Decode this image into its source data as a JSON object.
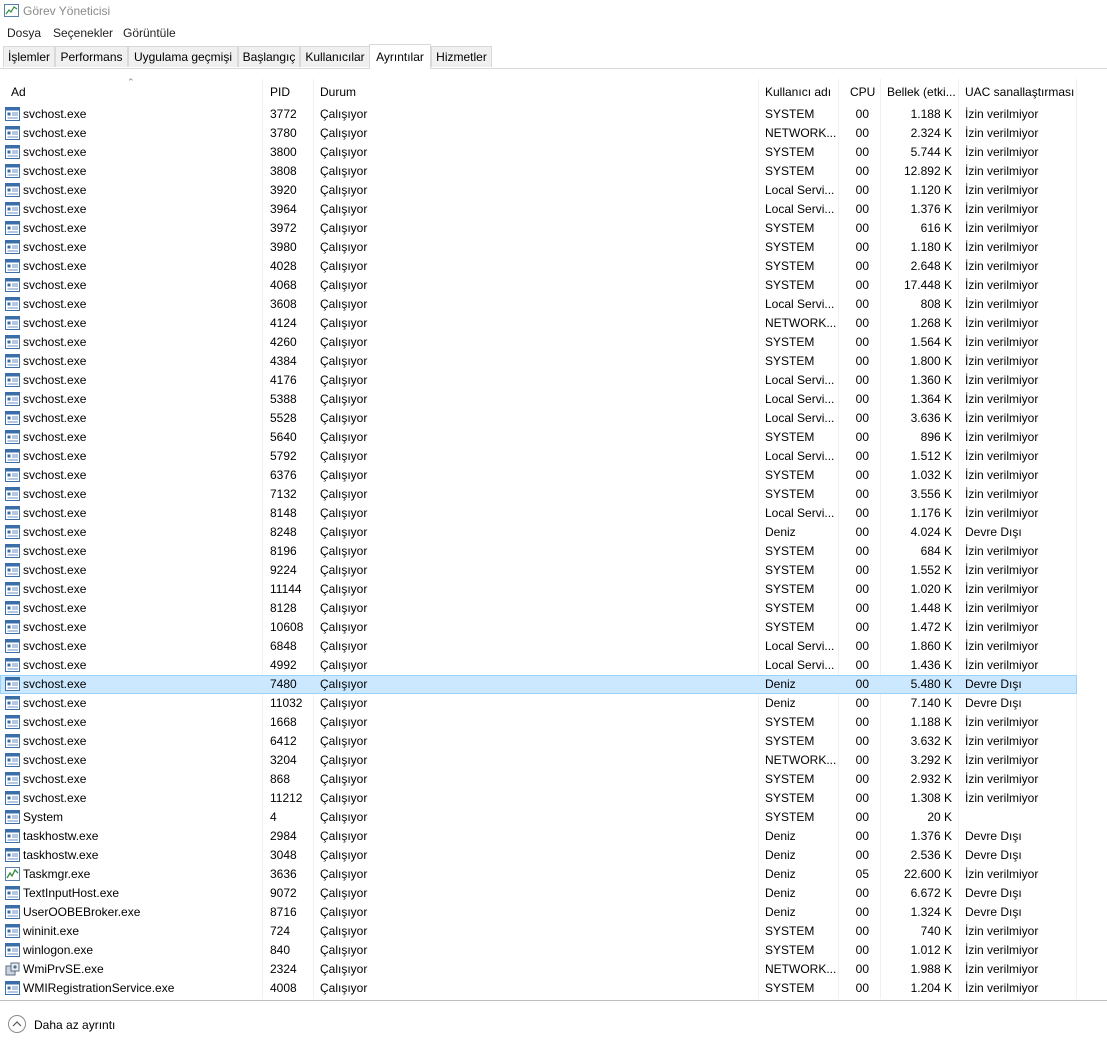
{
  "window": {
    "title": "Görev Yöneticisi"
  },
  "menu": [
    "Dosya",
    "Seçenekler",
    "Görüntüle"
  ],
  "tabs": [
    {
      "label": "İşlemler"
    },
    {
      "label": "Performans"
    },
    {
      "label": "Uygulama geçmişi"
    },
    {
      "label": "Başlangıç"
    },
    {
      "label": "Kullanıcılar"
    },
    {
      "label": "Ayrıntılar",
      "active": true
    },
    {
      "label": "Hizmetler"
    }
  ],
  "columns": {
    "name": "Ad",
    "pid": "PID",
    "status": "Durum",
    "user": "Kullanıcı adı",
    "cpu": "CPU",
    "memory": "Bellek (etki...",
    "uac": "UAC sanallaştırması"
  },
  "rows": [
    {
      "name": "svchost.exe",
      "pid": "3772",
      "status": "Çalışıyor",
      "user": "SYSTEM",
      "cpu": "00",
      "memory": "1.188 K",
      "uac": "İzin verilmiyor",
      "icon": "service"
    },
    {
      "name": "svchost.exe",
      "pid": "3780",
      "status": "Çalışıyor",
      "user": "NETWORK...",
      "cpu": "00",
      "memory": "2.324 K",
      "uac": "İzin verilmiyor",
      "icon": "service"
    },
    {
      "name": "svchost.exe",
      "pid": "3800",
      "status": "Çalışıyor",
      "user": "SYSTEM",
      "cpu": "00",
      "memory": "5.744 K",
      "uac": "İzin verilmiyor",
      "icon": "service"
    },
    {
      "name": "svchost.exe",
      "pid": "3808",
      "status": "Çalışıyor",
      "user": "SYSTEM",
      "cpu": "00",
      "memory": "12.892 K",
      "uac": "İzin verilmiyor",
      "icon": "service"
    },
    {
      "name": "svchost.exe",
      "pid": "3920",
      "status": "Çalışıyor",
      "user": "Local Servi...",
      "cpu": "00",
      "memory": "1.120 K",
      "uac": "İzin verilmiyor",
      "icon": "service"
    },
    {
      "name": "svchost.exe",
      "pid": "3964",
      "status": "Çalışıyor",
      "user": "Local Servi...",
      "cpu": "00",
      "memory": "1.376 K",
      "uac": "İzin verilmiyor",
      "icon": "service"
    },
    {
      "name": "svchost.exe",
      "pid": "3972",
      "status": "Çalışıyor",
      "user": "SYSTEM",
      "cpu": "00",
      "memory": "616 K",
      "uac": "İzin verilmiyor",
      "icon": "service"
    },
    {
      "name": "svchost.exe",
      "pid": "3980",
      "status": "Çalışıyor",
      "user": "SYSTEM",
      "cpu": "00",
      "memory": "1.180 K",
      "uac": "İzin verilmiyor",
      "icon": "service"
    },
    {
      "name": "svchost.exe",
      "pid": "4028",
      "status": "Çalışıyor",
      "user": "SYSTEM",
      "cpu": "00",
      "memory": "2.648 K",
      "uac": "İzin verilmiyor",
      "icon": "service"
    },
    {
      "name": "svchost.exe",
      "pid": "4068",
      "status": "Çalışıyor",
      "user": "SYSTEM",
      "cpu": "00",
      "memory": "17.448 K",
      "uac": "İzin verilmiyor",
      "icon": "service"
    },
    {
      "name": "svchost.exe",
      "pid": "3608",
      "status": "Çalışıyor",
      "user": "Local Servi...",
      "cpu": "00",
      "memory": "808 K",
      "uac": "İzin verilmiyor",
      "icon": "service"
    },
    {
      "name": "svchost.exe",
      "pid": "4124",
      "status": "Çalışıyor",
      "user": "NETWORK...",
      "cpu": "00",
      "memory": "1.268 K",
      "uac": "İzin verilmiyor",
      "icon": "service"
    },
    {
      "name": "svchost.exe",
      "pid": "4260",
      "status": "Çalışıyor",
      "user": "SYSTEM",
      "cpu": "00",
      "memory": "1.564 K",
      "uac": "İzin verilmiyor",
      "icon": "service"
    },
    {
      "name": "svchost.exe",
      "pid": "4384",
      "status": "Çalışıyor",
      "user": "SYSTEM",
      "cpu": "00",
      "memory": "1.800 K",
      "uac": "İzin verilmiyor",
      "icon": "service"
    },
    {
      "name": "svchost.exe",
      "pid": "4176",
      "status": "Çalışıyor",
      "user": "Local Servi...",
      "cpu": "00",
      "memory": "1.360 K",
      "uac": "İzin verilmiyor",
      "icon": "service"
    },
    {
      "name": "svchost.exe",
      "pid": "5388",
      "status": "Çalışıyor",
      "user": "Local Servi...",
      "cpu": "00",
      "memory": "1.364 K",
      "uac": "İzin verilmiyor",
      "icon": "service"
    },
    {
      "name": "svchost.exe",
      "pid": "5528",
      "status": "Çalışıyor",
      "user": "Local Servi...",
      "cpu": "00",
      "memory": "3.636 K",
      "uac": "İzin verilmiyor",
      "icon": "service"
    },
    {
      "name": "svchost.exe",
      "pid": "5640",
      "status": "Çalışıyor",
      "user": "SYSTEM",
      "cpu": "00",
      "memory": "896 K",
      "uac": "İzin verilmiyor",
      "icon": "service"
    },
    {
      "name": "svchost.exe",
      "pid": "5792",
      "status": "Çalışıyor",
      "user": "Local Servi...",
      "cpu": "00",
      "memory": "1.512 K",
      "uac": "İzin verilmiyor",
      "icon": "service"
    },
    {
      "name": "svchost.exe",
      "pid": "6376",
      "status": "Çalışıyor",
      "user": "SYSTEM",
      "cpu": "00",
      "memory": "1.032 K",
      "uac": "İzin verilmiyor",
      "icon": "service"
    },
    {
      "name": "svchost.exe",
      "pid": "7132",
      "status": "Çalışıyor",
      "user": "SYSTEM",
      "cpu": "00",
      "memory": "3.556 K",
      "uac": "İzin verilmiyor",
      "icon": "service"
    },
    {
      "name": "svchost.exe",
      "pid": "8148",
      "status": "Çalışıyor",
      "user": "Local Servi...",
      "cpu": "00",
      "memory": "1.176 K",
      "uac": "İzin verilmiyor",
      "icon": "service"
    },
    {
      "name": "svchost.exe",
      "pid": "8248",
      "status": "Çalışıyor",
      "user": "Deniz",
      "cpu": "00",
      "memory": "4.024 K",
      "uac": "Devre Dışı",
      "icon": "service"
    },
    {
      "name": "svchost.exe",
      "pid": "8196",
      "status": "Çalışıyor",
      "user": "SYSTEM",
      "cpu": "00",
      "memory": "684 K",
      "uac": "İzin verilmiyor",
      "icon": "service"
    },
    {
      "name": "svchost.exe",
      "pid": "9224",
      "status": "Çalışıyor",
      "user": "SYSTEM",
      "cpu": "00",
      "memory": "1.552 K",
      "uac": "İzin verilmiyor",
      "icon": "service"
    },
    {
      "name": "svchost.exe",
      "pid": "11144",
      "status": "Çalışıyor",
      "user": "SYSTEM",
      "cpu": "00",
      "memory": "1.020 K",
      "uac": "İzin verilmiyor",
      "icon": "service"
    },
    {
      "name": "svchost.exe",
      "pid": "8128",
      "status": "Çalışıyor",
      "user": "SYSTEM",
      "cpu": "00",
      "memory": "1.448 K",
      "uac": "İzin verilmiyor",
      "icon": "service"
    },
    {
      "name": "svchost.exe",
      "pid": "10608",
      "status": "Çalışıyor",
      "user": "SYSTEM",
      "cpu": "00",
      "memory": "1.472 K",
      "uac": "İzin verilmiyor",
      "icon": "service"
    },
    {
      "name": "svchost.exe",
      "pid": "6848",
      "status": "Çalışıyor",
      "user": "Local Servi...",
      "cpu": "00",
      "memory": "1.860 K",
      "uac": "İzin verilmiyor",
      "icon": "service"
    },
    {
      "name": "svchost.exe",
      "pid": "4992",
      "status": "Çalışıyor",
      "user": "Local Servi...",
      "cpu": "00",
      "memory": "1.436 K",
      "uac": "İzin verilmiyor",
      "icon": "service"
    },
    {
      "name": "svchost.exe",
      "pid": "7480",
      "status": "Çalışıyor",
      "user": "Deniz",
      "cpu": "00",
      "memory": "5.480 K",
      "uac": "Devre Dışı",
      "icon": "service",
      "selected": true
    },
    {
      "name": "svchost.exe",
      "pid": "11032",
      "status": "Çalışıyor",
      "user": "Deniz",
      "cpu": "00",
      "memory": "7.140 K",
      "uac": "Devre Dışı",
      "icon": "service"
    },
    {
      "name": "svchost.exe",
      "pid": "1668",
      "status": "Çalışıyor",
      "user": "SYSTEM",
      "cpu": "00",
      "memory": "1.188 K",
      "uac": "İzin verilmiyor",
      "icon": "service"
    },
    {
      "name": "svchost.exe",
      "pid": "6412",
      "status": "Çalışıyor",
      "user": "SYSTEM",
      "cpu": "00",
      "memory": "3.632 K",
      "uac": "İzin verilmiyor",
      "icon": "service"
    },
    {
      "name": "svchost.exe",
      "pid": "3204",
      "status": "Çalışıyor",
      "user": "NETWORK...",
      "cpu": "00",
      "memory": "3.292 K",
      "uac": "İzin verilmiyor",
      "icon": "service"
    },
    {
      "name": "svchost.exe",
      "pid": "868",
      "status": "Çalışıyor",
      "user": "SYSTEM",
      "cpu": "00",
      "memory": "2.932 K",
      "uac": "İzin verilmiyor",
      "icon": "service"
    },
    {
      "name": "svchost.exe",
      "pid": "11212",
      "status": "Çalışıyor",
      "user": "SYSTEM",
      "cpu": "00",
      "memory": "1.308 K",
      "uac": "İzin verilmiyor",
      "icon": "service"
    },
    {
      "name": "System",
      "pid": "4",
      "status": "Çalışıyor",
      "user": "SYSTEM",
      "cpu": "00",
      "memory": "20 K",
      "uac": "",
      "icon": "service"
    },
    {
      "name": "taskhostw.exe",
      "pid": "2984",
      "status": "Çalışıyor",
      "user": "Deniz",
      "cpu": "00",
      "memory": "1.376 K",
      "uac": "Devre Dışı",
      "icon": "service"
    },
    {
      "name": "taskhostw.exe",
      "pid": "3048",
      "status": "Çalışıyor",
      "user": "Deniz",
      "cpu": "00",
      "memory": "2.536 K",
      "uac": "Devre Dışı",
      "icon": "service"
    },
    {
      "name": "Taskmgr.exe",
      "pid": "3636",
      "status": "Çalışıyor",
      "user": "Deniz",
      "cpu": "05",
      "memory": "22.600 K",
      "uac": "İzin verilmiyor",
      "icon": "taskmgr"
    },
    {
      "name": "TextInputHost.exe",
      "pid": "9072",
      "status": "Çalışıyor",
      "user": "Deniz",
      "cpu": "00",
      "memory": "6.672 K",
      "uac": "Devre Dışı",
      "icon": "service"
    },
    {
      "name": "UserOOBEBroker.exe",
      "pid": "8716",
      "status": "Çalışıyor",
      "user": "Deniz",
      "cpu": "00",
      "memory": "1.324 K",
      "uac": "Devre Dışı",
      "icon": "service"
    },
    {
      "name": "wininit.exe",
      "pid": "724",
      "status": "Çalışıyor",
      "user": "SYSTEM",
      "cpu": "00",
      "memory": "740 K",
      "uac": "İzin verilmiyor",
      "icon": "service"
    },
    {
      "name": "winlogon.exe",
      "pid": "840",
      "status": "Çalışıyor",
      "user": "SYSTEM",
      "cpu": "00",
      "memory": "1.012 K",
      "uac": "İzin verilmiyor",
      "icon": "service"
    },
    {
      "name": "WmiPrvSE.exe",
      "pid": "2324",
      "status": "Çalışıyor",
      "user": "NETWORK...",
      "cpu": "00",
      "memory": "1.988 K",
      "uac": "İzin verilmiyor",
      "icon": "wmi"
    },
    {
      "name": "WMIRegistrationService.exe",
      "pid": "4008",
      "status": "Çalışıyor",
      "user": "SYSTEM",
      "cpu": "00",
      "memory": "1.204 K",
      "uac": "İzin verilmiyor",
      "icon": "service"
    }
  ],
  "footer": {
    "fewer_details": "Daha az ayrıntı"
  },
  "colors": {
    "selection_bg": "#cce8ff",
    "selection_border": "#99d1ff",
    "tab_bg": "#f0f0f0"
  }
}
